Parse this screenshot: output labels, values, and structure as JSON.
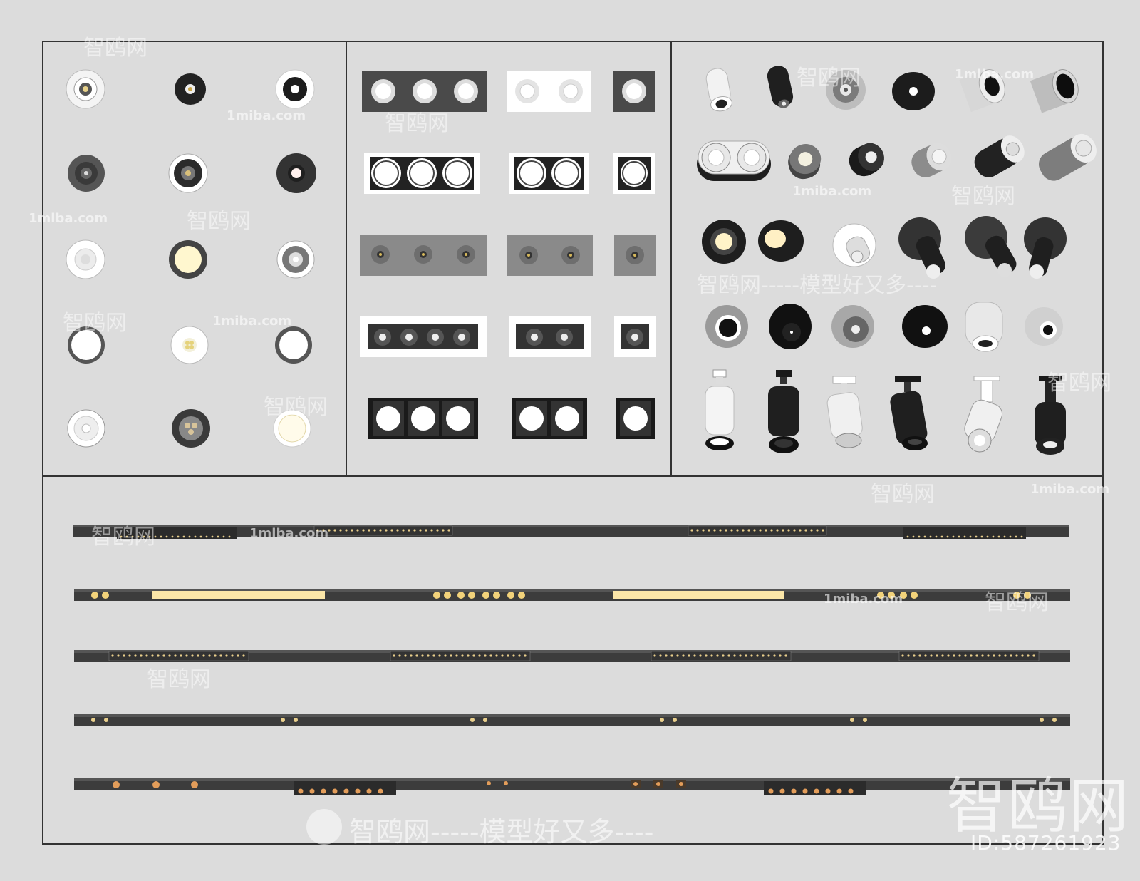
{
  "watermarks": {
    "brand_cn": "智鸥网",
    "site": "1miba.com",
    "slogan": "智鸥网-----模型好又多----",
    "big_brand": "智鸥网",
    "id_label": "ID:587261923"
  },
  "colors": {
    "background": "#dcdcdc",
    "frame": "#333333",
    "fixture_dark": "#3a3a3a",
    "fixture_white": "#ffffff",
    "led_warm": "#f6d98e",
    "led_strip": "#fbe6a8"
  }
}
